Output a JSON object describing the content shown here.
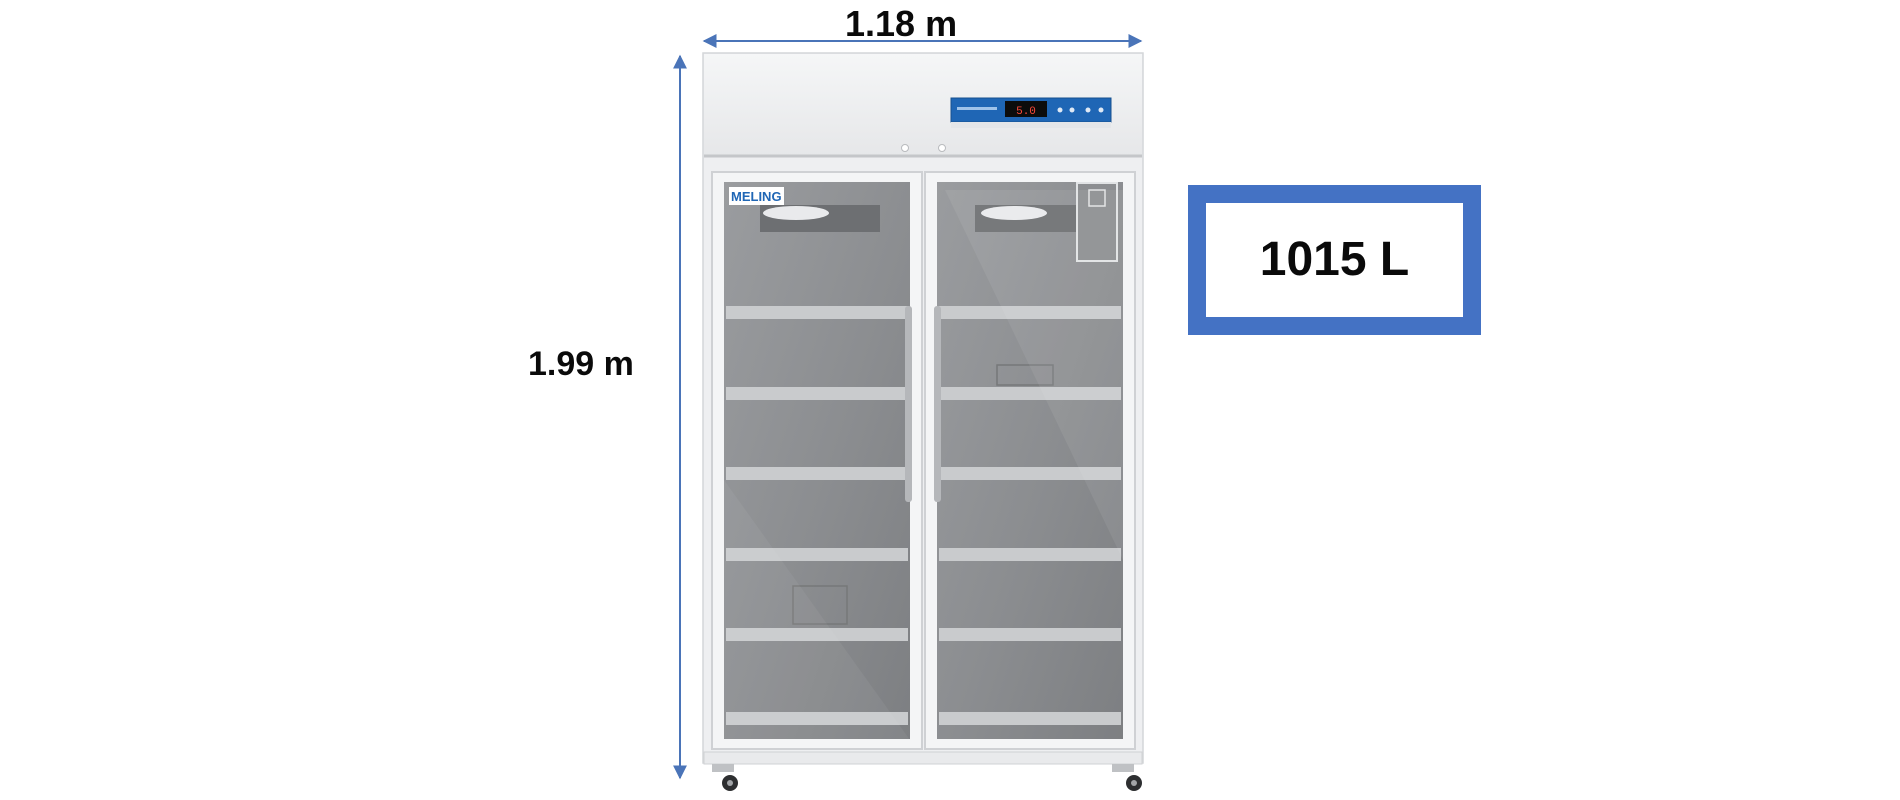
{
  "dimensions": {
    "width_label": "1.18 m",
    "height_label": "1.99 m"
  },
  "capacity": {
    "label": "1015 L"
  },
  "product": {
    "brand": "MELING",
    "display_reading": "5.0"
  },
  "colors": {
    "dimension_arrow": "#4a74b8",
    "capacity_border": "#4472c4",
    "cabinet_body": "#f1f2f4",
    "glass": "#8a8c8f",
    "shelf": "#c9cbcd",
    "control_panel": "#1f66b5"
  }
}
